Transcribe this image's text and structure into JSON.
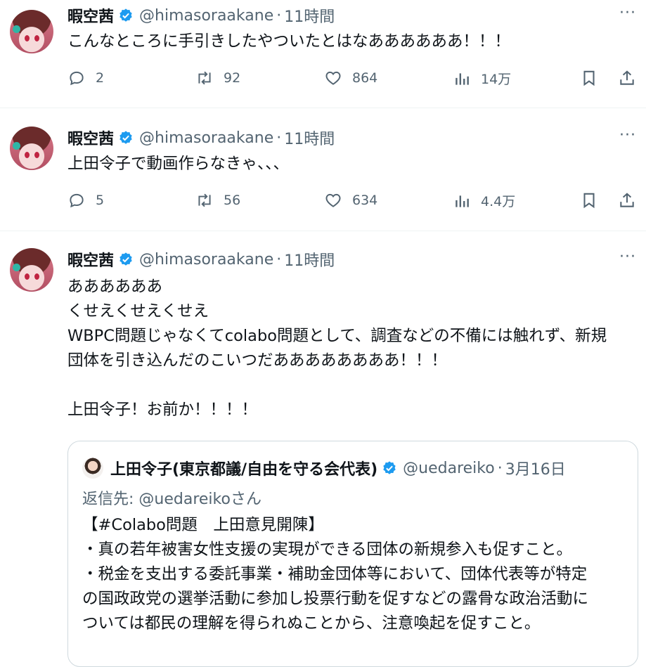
{
  "tweets": [
    {
      "display_name": "暇空茜",
      "handle": "@himasoraakane",
      "separator": "·",
      "time": "11時間",
      "text": "こんなところに手引きしたやついたとはなああああああ！！！",
      "replies": "2",
      "retweets": "92",
      "likes": "864",
      "views": "14万"
    },
    {
      "display_name": "暇空茜",
      "handle": "@himasoraakane",
      "separator": "·",
      "time": "11時間",
      "text": "上田令子で動画作らなきゃ、、、",
      "replies": "5",
      "retweets": "56",
      "likes": "634",
      "views": "4.4万"
    },
    {
      "display_name": "暇空茜",
      "handle": "@himasoraakane",
      "separator": "·",
      "time": "11時間",
      "text": "ああああああ\nくせえくせえくせえ\nWBPC問題じゃなくてcolabo問題として、調査などの不備には触れず、新規\n団体を引き込んだのこいつだああああああああ！！！\n\n上田令子！お前か！！！！"
    }
  ],
  "quoted_tweet": {
    "display_name": "上田令子(東京都議/自由を守る会代表)",
    "handle": "@uedareiko",
    "separator": "·",
    "time": "3月16日",
    "reply_to": "返信先: @uedareikoさん",
    "text": "【#Colabo問題　上田意見開陳】\n・真の若年被害女性支援の実現ができる団体の新規参入も促すこと。\n・税金を支出する委託事業・補助金団体等において、団体代表等が特定\nの国政政党の選挙活動に参加し投票行動を促すなどの露骨な政治活動に\nついては都民の理解を得られぬことから、注意喚起を促すこと。"
  },
  "more_label": "···",
  "colors": {
    "verified": "#1d9bf0",
    "secondary_text": "#536471",
    "border": "#cfd9de"
  },
  "icons": [
    "reply-icon",
    "retweet-icon",
    "like-icon",
    "views-icon",
    "bookmark-icon",
    "share-icon",
    "verified-icon",
    "more-icon"
  ]
}
